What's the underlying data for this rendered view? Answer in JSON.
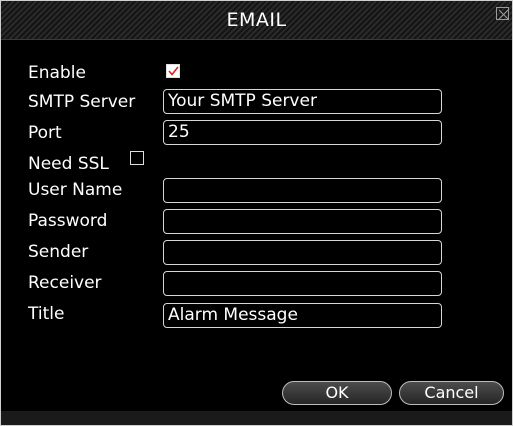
{
  "dialog": {
    "title": "EMAIL",
    "close_icon": "close-icon"
  },
  "form": {
    "enable": {
      "label": "Enable",
      "checked": true
    },
    "smtp_server": {
      "label": "SMTP Server",
      "value": "Your SMTP Server"
    },
    "port": {
      "label": "Port",
      "value": "25"
    },
    "need_ssl": {
      "label": "Need SSL",
      "checked": false
    },
    "user_name": {
      "label": "User Name",
      "value": ""
    },
    "password": {
      "label": "Password",
      "value": ""
    },
    "sender": {
      "label": "Sender",
      "value": ""
    },
    "receiver": {
      "label": "Receiver",
      "value": ""
    },
    "title": {
      "label": "Title",
      "value": "Alarm Message"
    }
  },
  "buttons": {
    "ok": "OK",
    "cancel": "Cancel"
  },
  "colors": {
    "background": "#000000",
    "text": "#ffffff",
    "check_mark": "#e0201c",
    "border": "#d6d6d6"
  }
}
